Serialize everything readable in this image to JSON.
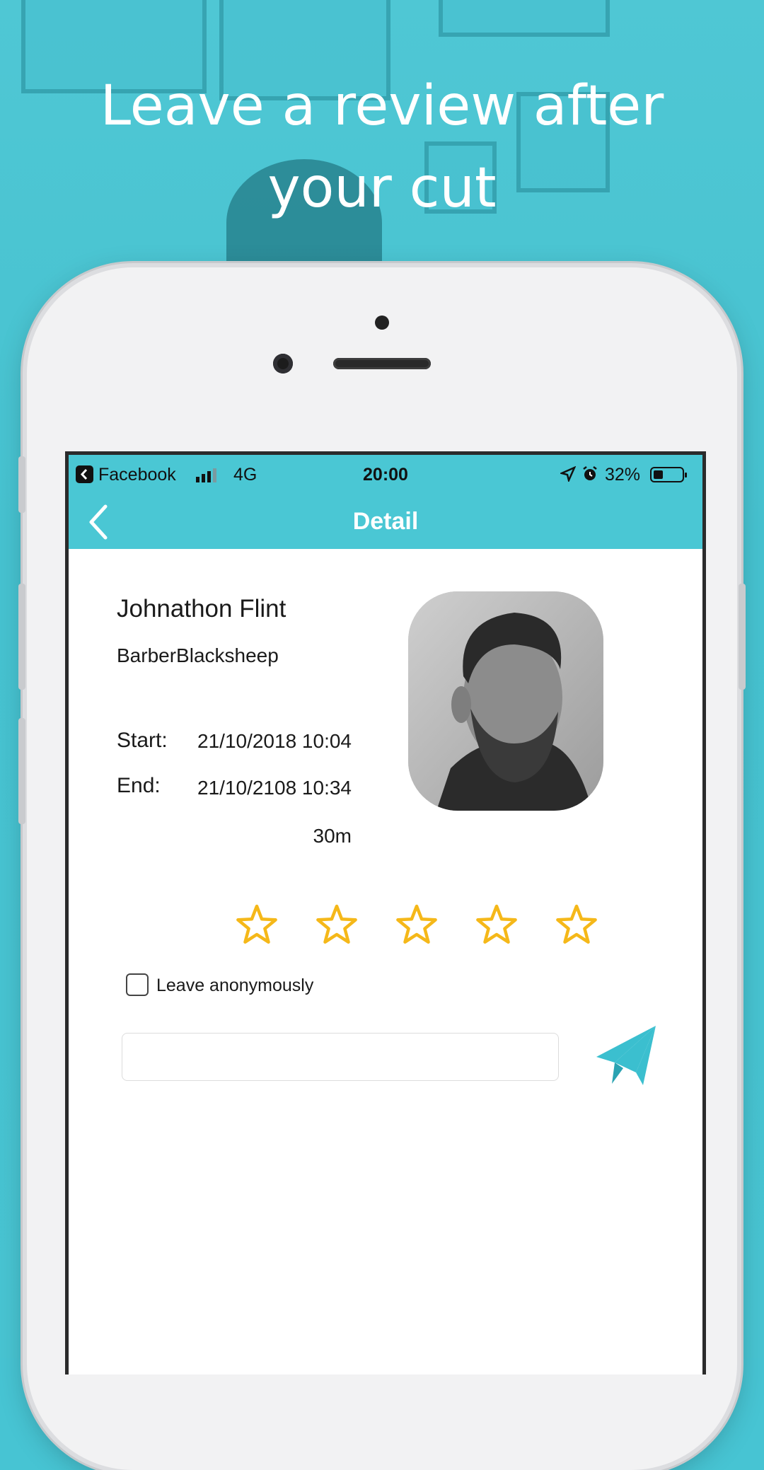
{
  "headline": "Leave a review after your cut",
  "status_bar": {
    "back_app": "Facebook",
    "network": "4G",
    "time": "20:00",
    "battery": "32%"
  },
  "nav": {
    "title": "Detail"
  },
  "booking": {
    "barber_name": "Johnathon Flint",
    "shop_name": "BarberBlacksheep",
    "start_label": "Start:",
    "start_value": "21/10/2018 10:04",
    "end_label": "End:",
    "end_value": "21/10/2108 10:34",
    "duration": "30m"
  },
  "rating": {
    "max_stars": 5,
    "selected": 0,
    "star_color": "#f5b819"
  },
  "anonymous_label": "Leave anonymously",
  "review_input": {
    "value": "",
    "placeholder": ""
  },
  "colors": {
    "accent": "#4ac7d4",
    "send_icon": "#3bbfcf"
  }
}
